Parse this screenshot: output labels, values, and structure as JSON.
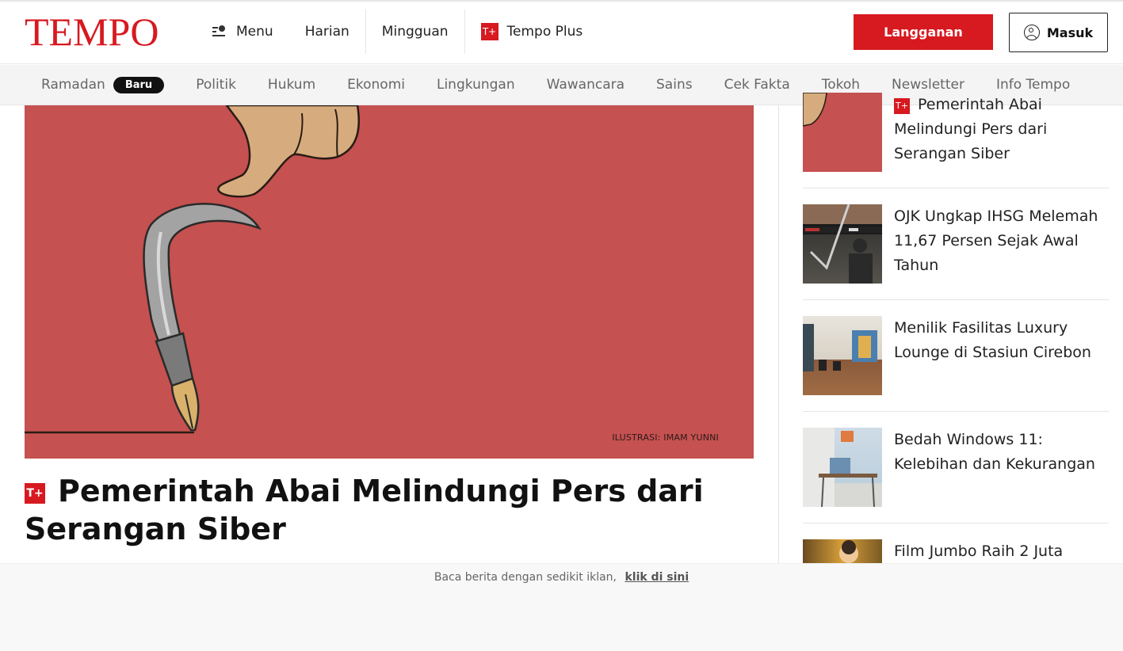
{
  "header": {
    "logo": "TEMPO",
    "nav": [
      {
        "label": "Menu"
      },
      {
        "label": "Harian"
      },
      {
        "label": "Mingguan"
      },
      {
        "label": "Tempo Plus"
      }
    ],
    "plus_badge": "T+",
    "subscribe_label": "Langganan",
    "login_label": "Masuk"
  },
  "categories": {
    "first": "Ramadan",
    "badge": "Baru",
    "items": [
      "Politik",
      "Hukum",
      "Ekonomi",
      "Lingkungan",
      "Wawancara",
      "Sains",
      "Cek Fakta",
      "Tokoh",
      "Newsletter",
      "Info Tempo"
    ]
  },
  "hero": {
    "credit": "ILUSTRASI: IMAM YUNNI",
    "plus_badge": "T+",
    "headline": "Pemerintah Abai Melindungi Pers dari Serangan Siber"
  },
  "sidebar": [
    {
      "title": "Pemerintah Abai Melindungi Pers dari Serangan Siber",
      "plus": true
    },
    {
      "title": "OJK Ungkap IHSG Melemah 11,67 Persen Sejak Awal Tahun",
      "plus": false
    },
    {
      "title": "Menilik Fasilitas Luxury Lounge di Stasiun Cirebon",
      "plus": false
    },
    {
      "title": "Bedah Windows 11: Kelebihan dan Kekurangan",
      "plus": false
    },
    {
      "title": "Film Jumbo Raih 2 Juta",
      "plus": false
    }
  ],
  "ad": {
    "text": "Baca berita dengan sedikit iklan,",
    "link": "klik di sini"
  },
  "colors": {
    "brand_red": "#d71920",
    "hero_background": "#c55150"
  }
}
